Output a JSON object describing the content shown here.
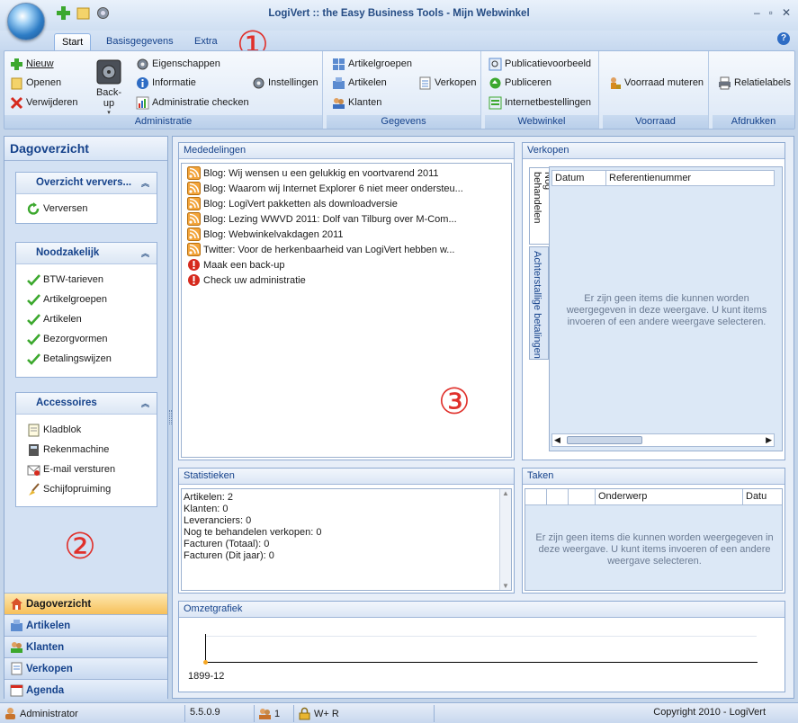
{
  "window": {
    "title": "LogiVert :: the Easy Business Tools - Mijn Webwinkel",
    "min": "–",
    "max": "▫",
    "close": "✕"
  },
  "ribbon_tabs": [
    "Start",
    "Basisgegevens",
    "Extra"
  ],
  "help": "?",
  "ribbon": {
    "administratie": {
      "label": "Administratie",
      "nieuw": "Nieuw",
      "openen": "Openen",
      "verwijderen": "Verwijderen",
      "backup": "Back-up",
      "eigenschappen": "Eigenschappen",
      "informatie": "Informatie",
      "check": "Administratie checken",
      "instellingen": "Instellingen"
    },
    "gegevens": {
      "label": "Gegevens",
      "artikelgroepen": "Artikelgroepen",
      "artikelen": "Artikelen",
      "klanten": "Klanten",
      "verkopen": "Verkopen"
    },
    "webwinkel": {
      "label": "Webwinkel",
      "voorbeeld": "Publicatievoorbeeld",
      "publiceren": "Publiceren",
      "bestellingen": "Internetbestellingen"
    },
    "voorraad": {
      "label": "Voorraad",
      "muteren": "Voorraad muteren"
    },
    "afdrukken": {
      "label": "Afdrukken",
      "relatielabels": "Relatielabels"
    }
  },
  "left": {
    "header": "Dagoverzicht",
    "cards": [
      {
        "title": "Overzicht ververs...",
        "items": [
          "Verversen"
        ]
      },
      {
        "title": "Noodzakelijk",
        "items": [
          "BTW-tarieven",
          "Artikelgroepen",
          "Artikelen",
          "Bezorgvormen",
          "Betalingswijzen"
        ]
      },
      {
        "title": "Accessoires",
        "items": [
          "Kladblok",
          "Rekenmachine",
          "E-mail versturen",
          "Schijfopruiming"
        ]
      }
    ],
    "nav": [
      "Dagoverzicht",
      "Artikelen",
      "Klanten",
      "Verkopen",
      "Agenda"
    ]
  },
  "mededelingen": {
    "title": "Mededelingen",
    "rss": [
      "Blog: Wij wensen u een gelukkig en voortvarend 2011",
      "Blog: Waarom wij Internet Explorer 6 niet meer ondersteu...",
      "Blog: LogiVert pakketten als downloadversie",
      "Blog: Lezing WWVD 2011: Dolf van Tilburg over M-Com...",
      "Blog: Webwinkelvakdagen 2011",
      "Twitter: Voor de herkenbaarheid van LogiVert hebben w..."
    ],
    "alerts": [
      "Maak een back-up",
      "Check uw administratie"
    ]
  },
  "verkopen": {
    "title": "Verkopen",
    "vtabs": [
      "Nog behandelen",
      "Achterstallige betalingen"
    ],
    "columns": [
      "Datum",
      "Referentienummer"
    ],
    "empty": "Er zijn geen items die kunnen worden weergegeven in deze weergave. U kunt items invoeren of een andere weergave selecteren."
  },
  "statistieken": {
    "title": "Statistieken",
    "lines": [
      "Artikelen: 2",
      "Klanten: 0",
      "Leveranciers: 0",
      "Nog te behandelen verkopen: 0",
      "Facturen (Totaal): 0",
      "Facturen (Dit jaar): 0"
    ]
  },
  "taken": {
    "title": "Taken",
    "columns": [
      "Onderwerp",
      "Datu"
    ],
    "empty": "Er zijn geen items die kunnen worden weergegeven in deze weergave. U kunt items invoeren of een andere weergave selecteren."
  },
  "omzet": {
    "title": "Omzetgrafiek",
    "xlabel": "1899-12"
  },
  "status": {
    "user": "Administrator",
    "version": "5.5.0.9",
    "users": "1",
    "mode": "W+ R",
    "copyright": "Copyright 2010 - LogiVert"
  },
  "annotations": [
    "①",
    "②",
    "③"
  ],
  "colors": {
    "accent": "#15428b",
    "highlight": "#f7c05a",
    "annotation": "#e0302b"
  }
}
